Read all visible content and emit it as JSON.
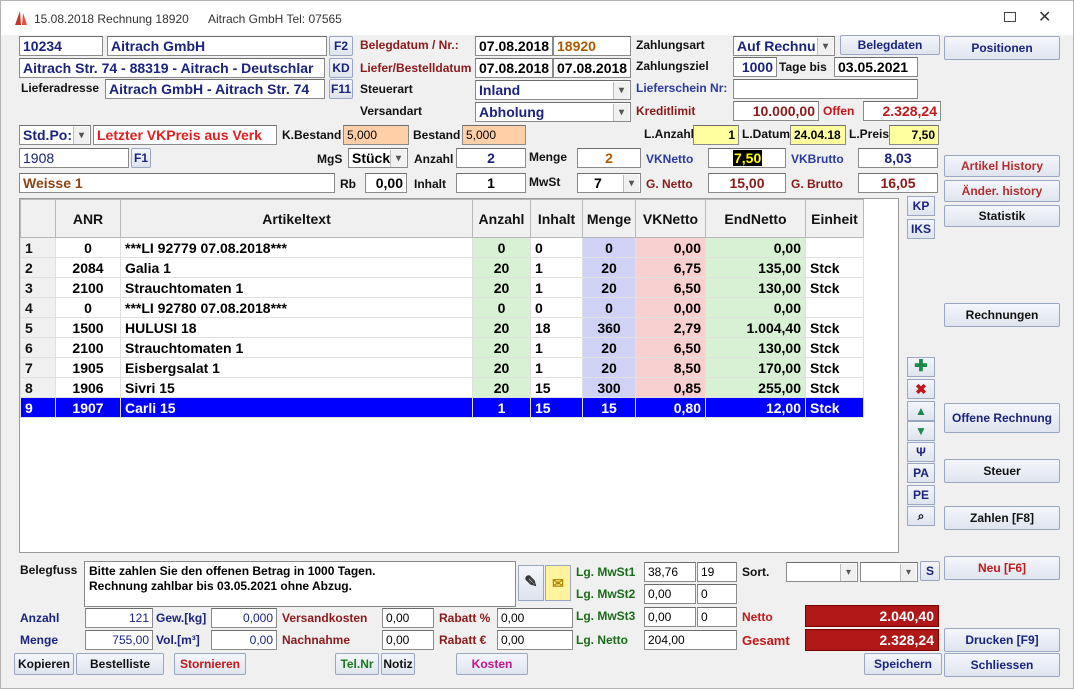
{
  "title": {
    "text": "15.08.2018  Rechnung 18920",
    "customer": "Aitrach GmbH  Tel: 07565"
  },
  "header": {
    "kunden_nr": "10234",
    "name": "Aitrach GmbH",
    "f2": "F2",
    "address": "Aitrach Str. 74 - 88319 - Aitrach - Deutschlar",
    "kd": "KD",
    "lieferadresse_label": "Lieferadresse",
    "lieferadresse": "Aitrach GmbH  - Aitrach Str. 74",
    "f11": "F11",
    "belegdatum_label": "Belegdatum / Nr.:",
    "belegdatum": "07.08.2018",
    "belegnr": "18920",
    "liefer_label": "Liefer/Bestelldatum",
    "lieferdatum": "07.08.2018",
    "bestelldatum": "07.08.2018",
    "steuerart_label": "Steuerart",
    "steuerart": "Inland",
    "versandart_label": "Versandart",
    "versandart": "Abholung",
    "zahlungsart_label": "Zahlungsart",
    "zahlungsart": "Auf Rechnu",
    "belegdaten_btn": "Belegdaten",
    "zahlungsziel_label": "Zahlungsziel",
    "zahlungsziel": "1000",
    "tage_bis": "Tage bis",
    "ziel_datum": "03.05.2021",
    "lieferschein_label": "Lieferschein Nr:",
    "lieferschein": "",
    "kreditlimit_label": "Kreditlimit",
    "kreditlimit": "10.000,00",
    "offen_label": "Offen",
    "offen": "2.328,24"
  },
  "article": {
    "preisart": "Std.Po:",
    "letzter": "Letzter VKPreis aus Verk",
    "kbestand_label": "K.Bestand",
    "kbestand": "5,000",
    "bestand_label": "Bestand",
    "bestand": "5,000",
    "lanzahl_label": "L.Anzahl",
    "lanzahl": "1",
    "ldatum_label": "L.Datum",
    "ldatum": "24.04.18",
    "lpreis_label": "L.Preis",
    "lpreis": "7,50",
    "anr": "1908",
    "f1": "F1",
    "mgs_label": "MgS",
    "mgs": "Stück",
    "anzahl_label": "Anzahl",
    "anzahl": "2",
    "menge_label": "Menge",
    "menge": "2",
    "vknetto_label": "VKNetto",
    "vknetto": "7,50",
    "vkbrutto_label": "VKBrutto",
    "vkbrutto": "8,03",
    "text": "Weisse 1",
    "rb_label": "Rb",
    "rb": "0,00",
    "inhalt_label": "Inhalt",
    "inhalt": "1",
    "mwst_label": "MwSt",
    "mwst": "7",
    "gnetto_label": "G. Netto",
    "gnetto": "15,00",
    "gbrutto_label": "G. Brutto",
    "gbrutto": "16,05"
  },
  "table": {
    "columns": [
      "ANR",
      "Artikeltext",
      "Anzahl",
      "Inhalt",
      "Menge",
      "VKNetto",
      "EndNetto",
      "Einheit"
    ],
    "rows": [
      {
        "n": "1",
        "anr": "0",
        "text": "***LI 92779 07.08.2018***",
        "anzahl": "0",
        "inhalt": "0",
        "menge": "0",
        "vk": "0,00",
        "end": "0,00",
        "einheit": ""
      },
      {
        "n": "2",
        "anr": "2084",
        "text": "Galia 1",
        "anzahl": "20",
        "inhalt": "1",
        "menge": "20",
        "vk": "6,75",
        "end": "135,00",
        "einheit": "Stck"
      },
      {
        "n": "3",
        "anr": "2100",
        "text": "Strauchtomaten 1",
        "anzahl": "20",
        "inhalt": "1",
        "menge": "20",
        "vk": "6,50",
        "end": "130,00",
        "einheit": "Stck"
      },
      {
        "n": "4",
        "anr": "0",
        "text": "***LI 92780 07.08.2018***",
        "anzahl": "0",
        "inhalt": "0",
        "menge": "0",
        "vk": "0,00",
        "end": "0,00",
        "einheit": ""
      },
      {
        "n": "5",
        "anr": "1500",
        "text": "HULUSI 18",
        "anzahl": "20",
        "inhalt": "18",
        "menge": "360",
        "vk": "2,79",
        "end": "1.004,40",
        "einheit": "Stck"
      },
      {
        "n": "6",
        "anr": "2100",
        "text": "Strauchtomaten 1",
        "anzahl": "20",
        "inhalt": "1",
        "menge": "20",
        "vk": "6,50",
        "end": "130,00",
        "einheit": "Stck"
      },
      {
        "n": "7",
        "anr": "1905",
        "text": "Eisbergsalat 1",
        "anzahl": "20",
        "inhalt": "1",
        "menge": "20",
        "vk": "8,50",
        "end": "170,00",
        "einheit": "Stck"
      },
      {
        "n": "8",
        "anr": "1906",
        "text": "Sivri 15",
        "anzahl": "20",
        "inhalt": "15",
        "menge": "300",
        "vk": "0,85",
        "end": "255,00",
        "einheit": "Stck"
      },
      {
        "n": "9",
        "anr": "1907",
        "text": "Carli 15",
        "anzahl": "1",
        "inhalt": "15",
        "menge": "15",
        "vk": "0,80",
        "end": "12,00",
        "einheit": "Stck",
        "selected": true
      }
    ]
  },
  "side_small": {
    "kp": "KP",
    "iks": "IKS",
    "pa": "PA",
    "pe": "PE"
  },
  "side_buttons": {
    "positionen": "Positionen",
    "artikel_history": "Artikel History",
    "aender_history": "Änder. history",
    "statistik": "Statistik",
    "rechnungen": "Rechnungen",
    "offene_rechnung": "Offene Rechnung",
    "steuer": "Steuer",
    "zahlen": "Zahlen [F8]",
    "neu": "Neu [F6]",
    "drucken": "Drucken [F9]",
    "schliessen": "Schliessen"
  },
  "footer": {
    "belegfuss_label": "Belegfuss",
    "belegfuss_line1": "Bitte zahlen Sie den offenen Betrag in 1000 Tagen.",
    "belegfuss_line2": "Rechnung zahlbar bis 03.05.2021 ohne Abzug.",
    "mwst1_label": "Lg. MwSt1",
    "mwst1": "38,76",
    "mwst1_rate": "19",
    "mwst2_label": "Lg. MwSt2",
    "mwst2": "0,00",
    "mwst2_rate": "0",
    "mwst3_label": "Lg. MwSt3",
    "mwst3": "0,00",
    "mwst3_rate": "0",
    "lgnetto_label": "Lg. Netto",
    "lgnetto": "204,00",
    "sort_label": "Sort.",
    "s_btn": "S",
    "netto_label": "Netto",
    "netto": "2.040,40",
    "gesamt_label": "Gesamt",
    "gesamt": "2.328,24",
    "anzahl_label": "Anzahl",
    "anzahl": "121",
    "gew_label": "Gew.[kg]",
    "gew": "0,000",
    "menge_label": "Menge",
    "menge": "755,00",
    "vol_label": "Vol.[m³]",
    "vol": "0,00",
    "versandkosten_label": "Versandkosten",
    "versandkosten": "0,00",
    "nachnahme_label": "Nachnahme",
    "nachnahme": "0,00",
    "rabatt_pct_label": "Rabatt %",
    "rabatt_pct": "0,00",
    "rabatt_eur_label": "Rabatt €",
    "rabatt_eur": "0,00"
  },
  "bottom_buttons": {
    "kopieren": "Kopieren",
    "bestelliste": "Bestelliste",
    "stornieren": "Stornieren",
    "telnr": "Tel.Nr",
    "notiz": "Notiz",
    "kosten": "Kosten",
    "speichern": "Speichern"
  },
  "colors": {
    "selected_row": "#0000ff",
    "netto_box": "#b01818",
    "input_orange": "#ffd0a8",
    "input_yellow": "#ffffa0"
  }
}
